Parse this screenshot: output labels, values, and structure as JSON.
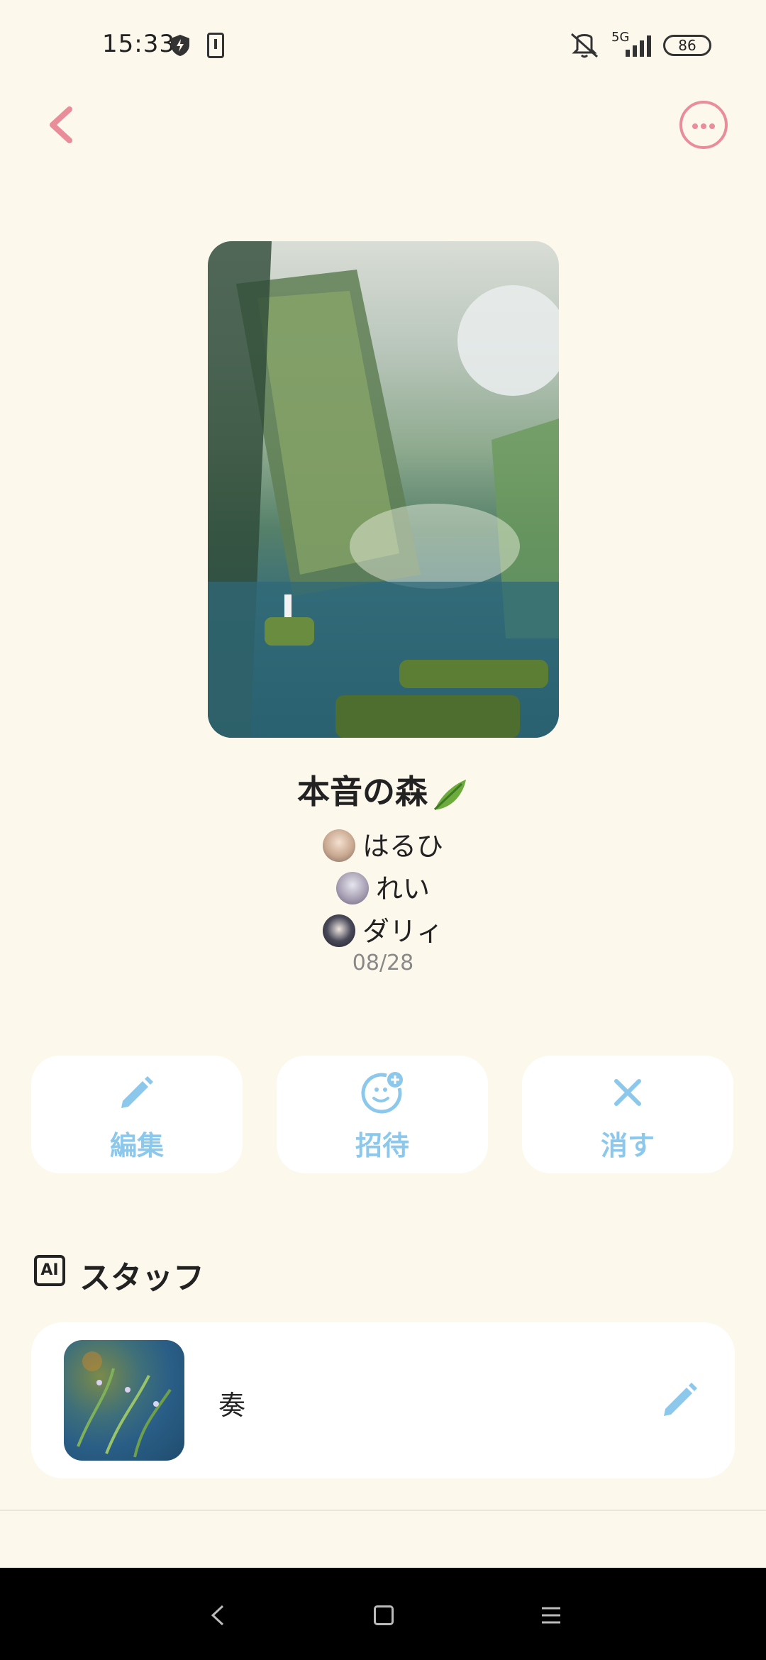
{
  "status_bar": {
    "time": "15:33",
    "network": "5G",
    "battery": "86"
  },
  "header": {
    "back_icon": "chevron-left-icon",
    "more_icon": "more-horizontal-icon",
    "accent_color": "#e98d9a"
  },
  "room": {
    "title": "本音の森",
    "title_emoji": "leaf-icon",
    "members": [
      {
        "name": "はるひ"
      },
      {
        "name": "れい"
      },
      {
        "name": "ダリィ"
      }
    ],
    "date": "08/28"
  },
  "actions": [
    {
      "label": "編集",
      "icon": "pencil-icon"
    },
    {
      "label": "招待",
      "icon": "add-friend-icon"
    },
    {
      "label": "消す",
      "icon": "close-icon"
    }
  ],
  "action_color": "#8cc8ec",
  "staff_section": {
    "badge": "AI",
    "title": "スタッフ",
    "items": [
      {
        "name": "奏",
        "edit_icon": "pencil-icon"
      }
    ]
  },
  "nav_bar": {
    "back_icon": "nav-back-icon",
    "home_icon": "nav-home-icon",
    "menu_icon": "nav-menu-icon"
  }
}
